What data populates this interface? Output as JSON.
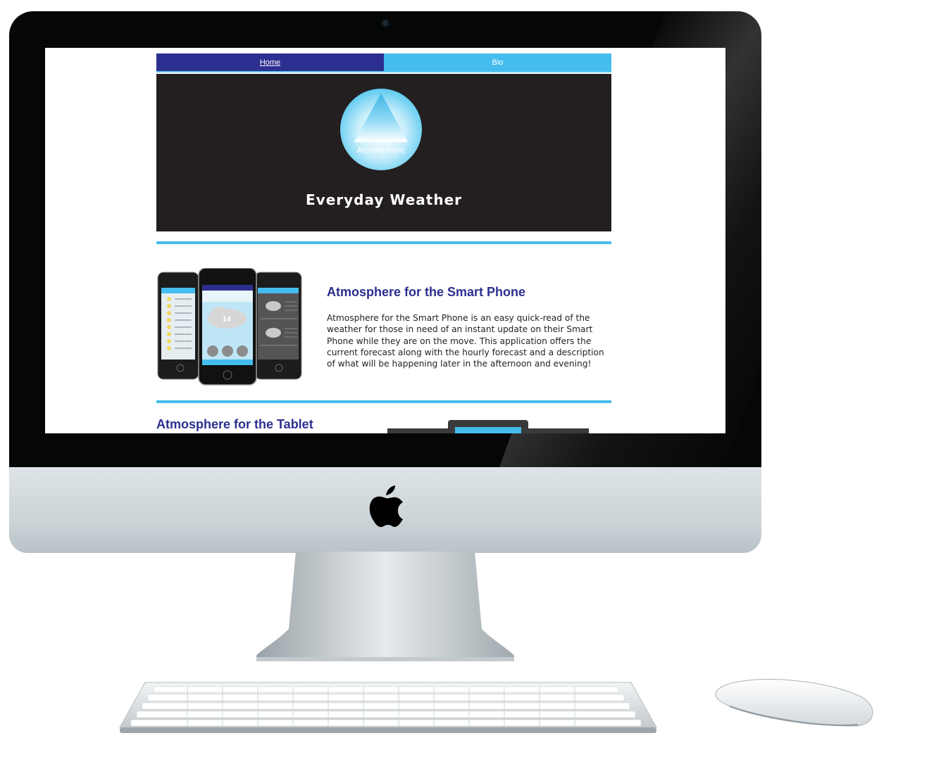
{
  "nav": {
    "home_label": "Home",
    "bio_label": "Bio"
  },
  "hero": {
    "logo_text": "Atmosphere",
    "tagline": "Everyday Weather"
  },
  "feature_phone": {
    "title": "Atmosphere for the Smart Phone",
    "body": "Atmosphere for the Smart Phone is an easy quick-read of the weather for those in need of an instant update on their Smart Phone while they are on the move. This application offers the current forecast along with the hourly forecast and a description of what will be happening later in the afternoon and evening!",
    "screenshot_temp": "14"
  },
  "feature_tablet": {
    "title": "Atmosphere for the Tablet"
  },
  "colors": {
    "nav_home": "#2c2f8f",
    "nav_bio": "#44bdee",
    "hero_bg": "#231f20",
    "accent": "#44bdee",
    "heading": "#2c2f8f"
  }
}
